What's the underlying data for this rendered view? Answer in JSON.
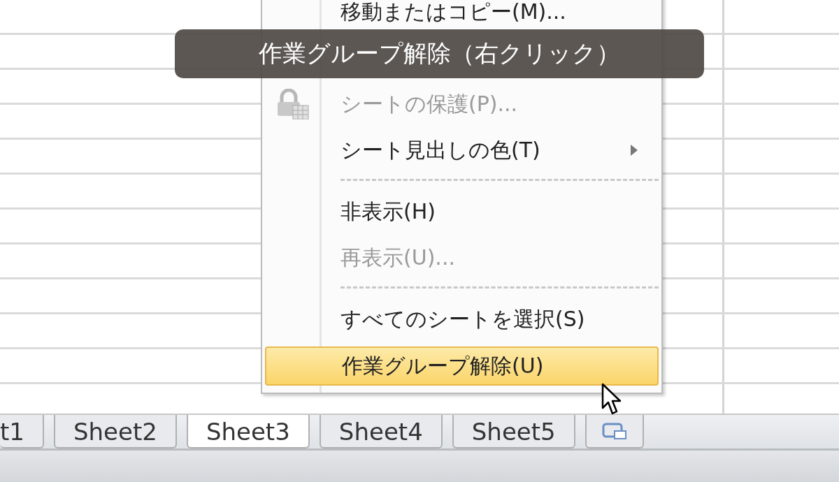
{
  "caption": "作業グループ解除（右クリック）",
  "menu": {
    "items": [
      {
        "kind": "item",
        "label": "移動またはコピー(M)...",
        "disabled": false,
        "highlighted": false,
        "submenu": false
      },
      {
        "kind": "covered"
      },
      {
        "kind": "lock-item",
        "label": "シートの保護(P)...",
        "disabled": true,
        "highlighted": false,
        "submenu": false
      },
      {
        "kind": "item",
        "label": "シート見出しの色(T)",
        "disabled": false,
        "highlighted": false,
        "submenu": true
      },
      {
        "kind": "separator"
      },
      {
        "kind": "item",
        "label": "非表示(H)",
        "disabled": false,
        "highlighted": false,
        "submenu": false
      },
      {
        "kind": "item",
        "label": "再表示(U)...",
        "disabled": true,
        "highlighted": false,
        "submenu": false
      },
      {
        "kind": "separator"
      },
      {
        "kind": "item",
        "label": "すべてのシートを選択(S)",
        "disabled": false,
        "highlighted": false,
        "submenu": false
      },
      {
        "kind": "item",
        "label": "作業グループ解除(U)",
        "disabled": false,
        "highlighted": true,
        "submenu": false
      }
    ]
  },
  "sheet_tabs": [
    {
      "kind": "sheet",
      "label": "t1",
      "selected": false
    },
    {
      "kind": "sheet",
      "label": "Sheet2",
      "selected": false
    },
    {
      "kind": "sheet",
      "label": "Sheet3",
      "selected": true
    },
    {
      "kind": "sheet",
      "label": "Sheet4",
      "selected": false
    },
    {
      "kind": "sheet",
      "label": "Sheet5",
      "selected": false
    },
    {
      "kind": "new",
      "selected": false
    }
  ]
}
